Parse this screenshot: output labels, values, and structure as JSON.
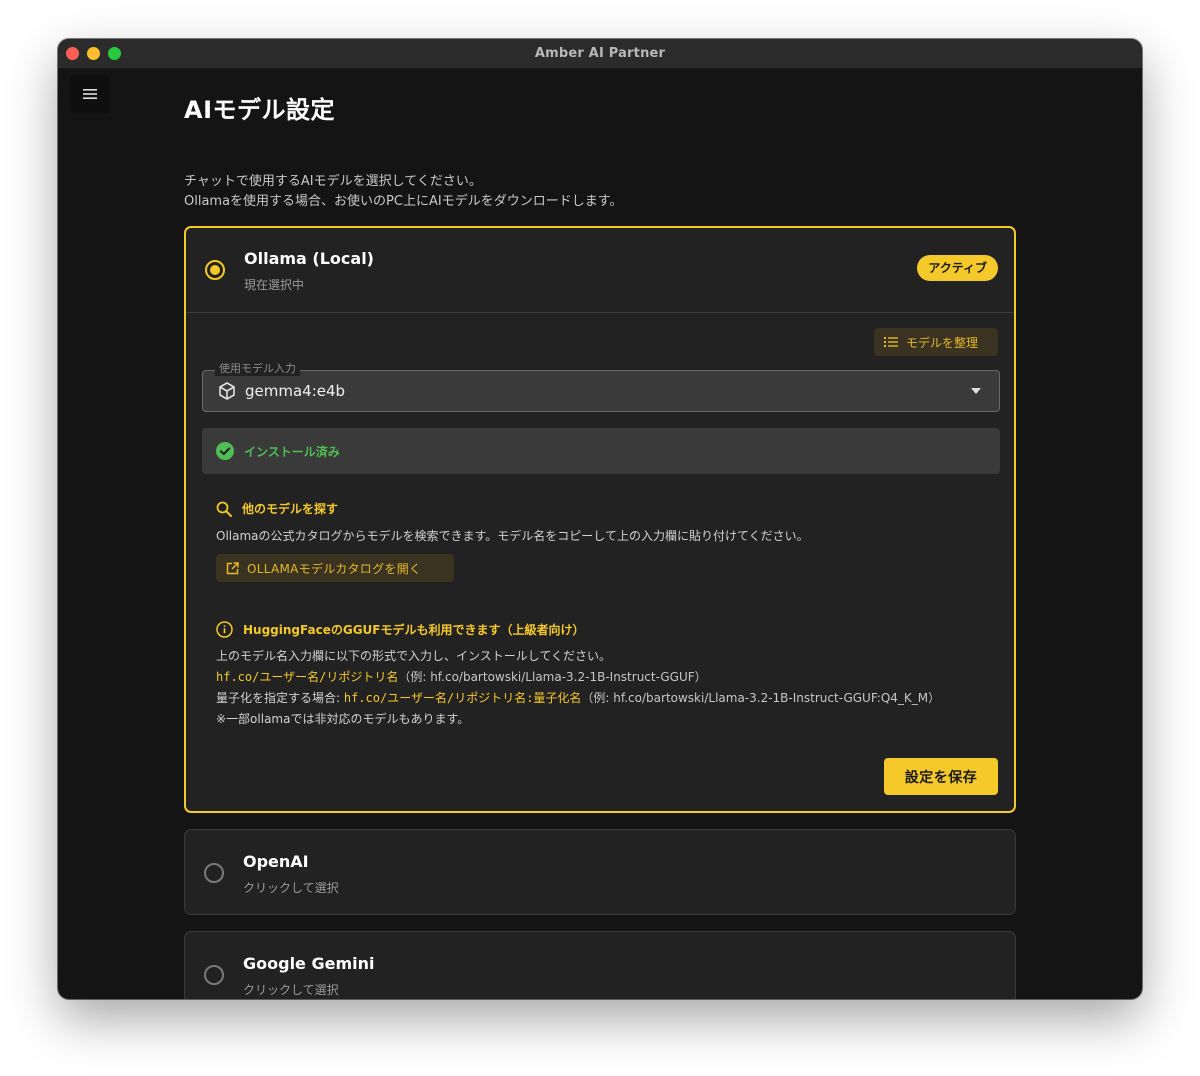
{
  "window": {
    "title": "Amber AI Partner"
  },
  "page": {
    "title": "AIモデル設定",
    "desc_line1": "チャットで使用するAIモデルを選択してください。",
    "desc_line2": "Ollamaを使用する場合、お使いのPC上にAIモデルをダウンロードします。"
  },
  "providers": [
    {
      "name": "Ollama (Local)",
      "subtitle": "現在選択中",
      "badge": "アクティブ",
      "selected": true,
      "organize_label": "モデルを整理",
      "model_field_label": "使用モデル入力",
      "model_value": "gemma4:e4b",
      "install_status": "インストール済み",
      "find_title": "他のモデルを探す",
      "find_desc": "Ollamaの公式カタログからモデルを検索できます。モデル名をコピーして上の入力欄に貼り付けてください。",
      "catalog_button": "OLLAMAモデルカタログを開く",
      "hf_title": "HuggingFaceのGGUFモデルも利用できます（上級者向け）",
      "hf_line1": "上のモデル名入力欄に以下の形式で入力し、インストールしてください。",
      "hf_line2_code": "hf.co/ユーザー名/リポジトリ名",
      "hf_line2_example": "（例: hf.co/bartowski/Llama-3.2-1B-Instruct-GGUF）",
      "hf_line3_prefix": "量子化を指定する場合: ",
      "hf_line3_code": "hf.co/ユーザー名/リポジトリ名:量子化名",
      "hf_line3_example": "（例: hf.co/bartowski/Llama-3.2-1B-Instruct-GGUF:Q4_K_M）",
      "hf_note": "※一部ollamaでは非対応のモデルもあります。",
      "save_button": "設定を保存"
    },
    {
      "name": "OpenAI",
      "subtitle": "クリックして選択",
      "selected": false
    },
    {
      "name": "Google Gemini",
      "subtitle": "クリックして選択",
      "selected": false
    }
  ],
  "colors": {
    "accent": "#f5c92a",
    "success": "#4fbf55",
    "background": "#141414",
    "card": "#222222"
  },
  "icons": [
    "menu-icon",
    "list-icon",
    "cube-icon",
    "dropdown-arrow-icon",
    "check-circle-icon",
    "search-icon",
    "open-external-icon",
    "info-icon"
  ]
}
